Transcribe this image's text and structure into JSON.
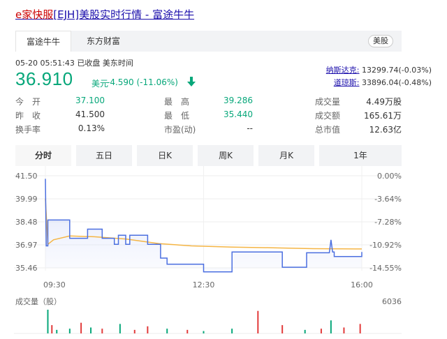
{
  "title": {
    "prefix": "e家快服",
    "rest": "[EJH]美股实时行情 - 富途牛牛"
  },
  "tabs": [
    {
      "label": "富途牛牛",
      "active": true
    },
    {
      "label": "东方财富",
      "active": false
    }
  ],
  "market_badge": "美股",
  "status": {
    "datetime": "05-20 05:51:43",
    "state": "已收盘",
    "timezone": "美东时间"
  },
  "price": {
    "value": "36.910",
    "unit": "美元",
    "change": "-4.590 (-11.06%)",
    "direction_icon": "down-arrow-icon",
    "color": "#07a77a"
  },
  "indices": [
    {
      "name": "纳斯达克:",
      "value": "13299.74(-0.03%)"
    },
    {
      "name": "道琼斯:",
      "value": "33896.04(-0.48%)"
    }
  ],
  "quote": {
    "open_label": "今　开",
    "open": "37.100",
    "prev_label": "昨　收",
    "prev": "41.500",
    "turnover_rate_label": "换手率",
    "turnover_rate": "0.13%",
    "high_label": "最　高",
    "high": "39.286",
    "low_label": "最　低",
    "low": "35.440",
    "pe_label": "市盈(动)",
    "pe": "--",
    "volume_label": "成交量",
    "volume": "4.49万股",
    "amount_label": "成交额",
    "amount": "165.61万",
    "market_cap_label": "总市值",
    "market_cap": "12.63亿"
  },
  "period_tabs": [
    {
      "label": "分时",
      "active": true
    },
    {
      "label": "五日",
      "active": false
    },
    {
      "label": "日K",
      "active": false
    },
    {
      "label": "周K",
      "active": false
    },
    {
      "label": "月K",
      "active": false
    },
    {
      "label": "1年",
      "active": false
    }
  ],
  "chart_data": {
    "type": "line",
    "y_ticks": [
      "41.50",
      "39.99",
      "38.48",
      "36.97",
      "35.46"
    ],
    "pct_ticks": [
      "0.00%",
      "-3.64%",
      "-7.28%",
      "-10.92%",
      "-14.55%"
    ],
    "x_ticks": [
      "09:30",
      "12:30",
      "16:00"
    ],
    "ylim": [
      35.46,
      41.5
    ],
    "x_range_minutes": [
      0,
      390
    ],
    "price_color": "#4b6fe0",
    "avg_color": "#f5b544",
    "price_series": [
      [
        0,
        41.3
      ],
      [
        1,
        36.9
      ],
      [
        3,
        36.9
      ],
      [
        3,
        38.6
      ],
      [
        30,
        38.6
      ],
      [
        30,
        37.4
      ],
      [
        52,
        37.4
      ],
      [
        52,
        38.0
      ],
      [
        70,
        38.0
      ],
      [
        70,
        37.4
      ],
      [
        85,
        37.4
      ],
      [
        85,
        37.0
      ],
      [
        90,
        37.0
      ],
      [
        90,
        37.6
      ],
      [
        99,
        37.6
      ],
      [
        99,
        37.0
      ],
      [
        104,
        37.0
      ],
      [
        104,
        37.6
      ],
      [
        126,
        37.6
      ],
      [
        126,
        37.0
      ],
      [
        142,
        37.0
      ],
      [
        142,
        36.1
      ],
      [
        150,
        36.1
      ],
      [
        150,
        35.7
      ],
      [
        195,
        35.7
      ],
      [
        195,
        35.2
      ],
      [
        230,
        35.2
      ],
      [
        230,
        36.5
      ],
      [
        292,
        36.5
      ],
      [
        292,
        35.5
      ],
      [
        322,
        35.5
      ],
      [
        322,
        36.45
      ],
      [
        350,
        36.45
      ],
      [
        352,
        37.3
      ],
      [
        354,
        36.5
      ],
      [
        356,
        36.5
      ],
      [
        356,
        36.2
      ],
      [
        390,
        36.2
      ],
      [
        390,
        36.5
      ]
    ],
    "avg_series": [
      [
        0,
        40.0
      ],
      [
        3,
        37.0
      ],
      [
        10,
        37.3
      ],
      [
        30,
        37.55
      ],
      [
        60,
        37.5
      ],
      [
        100,
        37.35
      ],
      [
        140,
        37.05
      ],
      [
        180,
        36.9
      ],
      [
        230,
        36.82
      ],
      [
        280,
        36.78
      ],
      [
        330,
        36.72
      ],
      [
        390,
        36.7
      ]
    ],
    "volume": {
      "label": "成交量（股）",
      "max_label": "6036",
      "bars": [
        {
          "t": 3,
          "v": 1.0,
          "dir": "up"
        },
        {
          "t": 8,
          "v": 0.35,
          "dir": "down"
        },
        {
          "t": 14,
          "v": 0.15,
          "dir": "up"
        },
        {
          "t": 30,
          "v": 0.2,
          "dir": "up"
        },
        {
          "t": 44,
          "v": 0.45,
          "dir": "down"
        },
        {
          "t": 56,
          "v": 0.25,
          "dir": "up"
        },
        {
          "t": 70,
          "v": 0.2,
          "dir": "down"
        },
        {
          "t": 92,
          "v": 0.4,
          "dir": "up"
        },
        {
          "t": 110,
          "v": 0.15,
          "dir": "down"
        },
        {
          "t": 126,
          "v": 0.3,
          "dir": "down"
        },
        {
          "t": 150,
          "v": 0.2,
          "dir": "up"
        },
        {
          "t": 175,
          "v": 0.15,
          "dir": "down"
        },
        {
          "t": 195,
          "v": 0.1,
          "dir": "up"
        },
        {
          "t": 230,
          "v": 0.2,
          "dir": "up"
        },
        {
          "t": 262,
          "v": 0.95,
          "dir": "down"
        },
        {
          "t": 292,
          "v": 0.35,
          "dir": "down"
        },
        {
          "t": 320,
          "v": 0.15,
          "dir": "up"
        },
        {
          "t": 340,
          "v": 0.2,
          "dir": "down"
        },
        {
          "t": 352,
          "v": 0.55,
          "dir": "up"
        },
        {
          "t": 368,
          "v": 0.25,
          "dir": "down"
        },
        {
          "t": 388,
          "v": 0.4,
          "dir": "down"
        }
      ],
      "up_color": "#07a77a",
      "down_color": "#e23a3a"
    }
  }
}
